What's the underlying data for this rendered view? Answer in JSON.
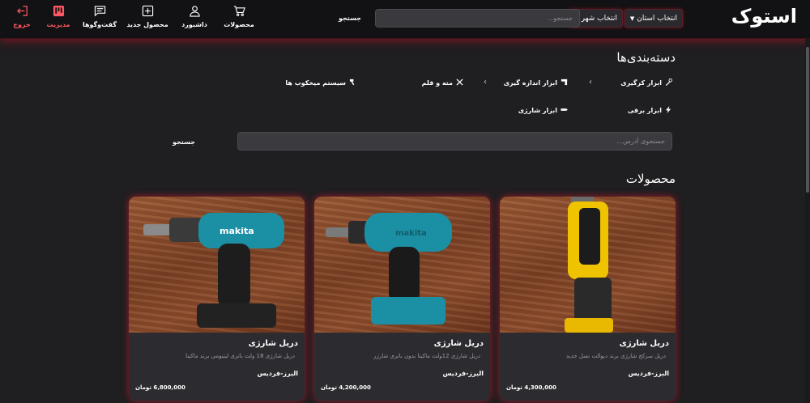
{
  "header": {
    "logo": "استوک",
    "province_select": "انتخاب استان",
    "city_select": "انتخاب شهر",
    "search_placeholder": "جستجو...",
    "search_button": "جستجو",
    "nav": [
      {
        "label": "محصولات",
        "icon": "cart-icon"
      },
      {
        "label": "داشبورد",
        "icon": "user-icon"
      },
      {
        "label": "محصول جدید",
        "icon": "plus-square-icon"
      },
      {
        "label": "گفت‌وگوها",
        "icon": "chat-icon"
      },
      {
        "label": "مدیریت",
        "icon": "kanban-icon"
      },
      {
        "label": "خروج",
        "icon": "logout-icon"
      }
    ],
    "colors": {
      "accent": "#ff5a64",
      "glow": "#c8192d"
    }
  },
  "categories": {
    "title": "دسته‌بندی‌ها",
    "items": [
      {
        "label": "ابزار کرگیری",
        "icon": "wrench-icon"
      },
      {
        "label": "ابزار اندازه گیری",
        "icon": "ruler-icon"
      },
      {
        "label": "مته و قلم",
        "icon": "tools-icon"
      },
      {
        "label": "سیستم میخکوب ها",
        "icon": "hammer-icon"
      },
      {
        "label": "ابزار برقی",
        "icon": "lightning-icon"
      },
      {
        "label": "ابزار شارژی",
        "icon": "battery-icon"
      }
    ]
  },
  "address_search": {
    "placeholder": "جستجوی آدرس...",
    "button": "جستجو"
  },
  "products": {
    "title": "محصولات",
    "items": [
      {
        "name": "دریل شارژی",
        "description": "دریل سرکج شارژی برند دیوالت نسل جدید",
        "location": "البرز-فردیس",
        "price": "4,300,000 تومان"
      },
      {
        "name": "دریل شارژی",
        "description": "دریل شارژی 12ولت ماکیتا بدون باتری شارژر",
        "location": "البرز-فردیس",
        "price": "4,200,000 تومان"
      },
      {
        "name": "دریل شارژی",
        "description": "دریل شارژی 18 ولت باتری لیتیومی برند ماکیتا",
        "location": "البرز-فردیس",
        "price": "6,800,000 تومان"
      }
    ]
  }
}
